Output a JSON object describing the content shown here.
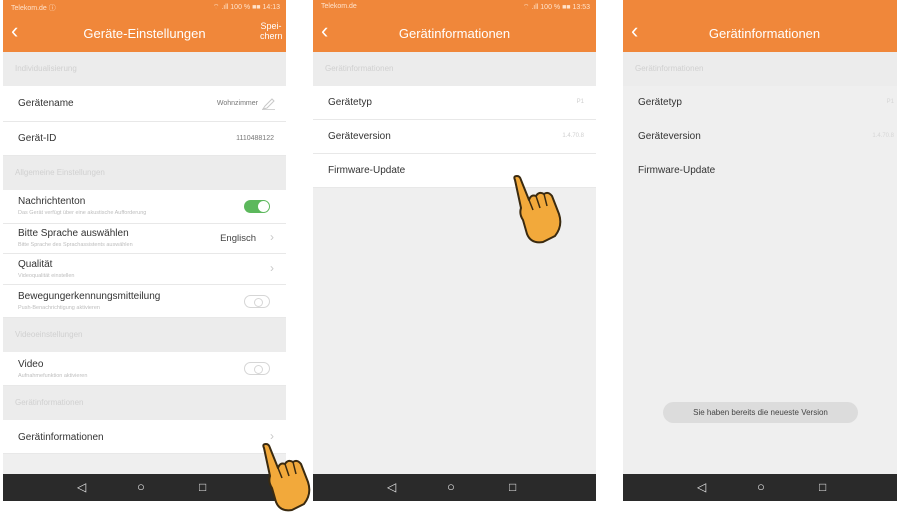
{
  "screen1": {
    "status_left": "Telekom.de ⓘ",
    "status_right": "⌔ .ıll 100 % ■■ 14:13",
    "title": "Geräte-Einstellungen",
    "save_label": "Spei-\nchern",
    "section_individual": "Individualisierung",
    "device_name_label": "Gerätename",
    "device_name_value": "Wohnzimmer",
    "device_id_label": "Gerät-ID",
    "device_id_value": "1110488122",
    "section_general": "Allgemeine Einstellungen",
    "notification_tone_label": "Nachrichtenton",
    "notification_tone_sub": "Das Gerät verfügt über eine akustische Aufforderung",
    "notification_tone_on": true,
    "language_label": "Bitte Sprache auswählen",
    "language_sub": "Bitte Sprache des Sprachassistents auswählen",
    "language_value": "Englisch",
    "quality_label": "Qualität",
    "quality_sub": "Videoqualität einstellen",
    "motion_label": "Bewegungerkennungsmitteilung",
    "motion_sub": "Push-Benachrichtigung aktivieren",
    "motion_on": false,
    "section_video": "Videoeinstellungen",
    "video_label": "Video",
    "video_sub": "Aufnahmefunktion aktivieren",
    "video_on": false,
    "section_info": "Gerätinformationen",
    "device_info_label": "Gerätinformationen"
  },
  "screen2": {
    "status_left": "Telekom.de",
    "status_right": "⌔ .ıll 100 % ■■ 13:53",
    "title": "Gerätinformationen",
    "section": "Gerätinformationen",
    "type_label": "Gerätetyp",
    "type_value": "P1",
    "version_label": "Geräteversion",
    "version_value": "1.4.70.8",
    "firmware_label": "Firmware-Update"
  },
  "screen3": {
    "title": "Gerätinformationen",
    "section": "Gerätinformationen",
    "type_label": "Gerätetyp",
    "type_value": "P1",
    "version_label": "Geräteversion",
    "version_value": "1.4.70.8",
    "firmware_label": "Firmware-Update",
    "toast": "Sie haben bereits die neueste Version"
  },
  "nav": {
    "back": "◁",
    "home": "○",
    "recent": "□"
  },
  "icons": {
    "back": "chevron-left-icon",
    "edit": "pencil-icon",
    "hand": "pointing-hand-icon"
  },
  "colors": {
    "accent": "#f0873a",
    "toggle_on": "#5cb85c",
    "navbar": "#2a2a2a",
    "hand": "#f2a93b"
  }
}
